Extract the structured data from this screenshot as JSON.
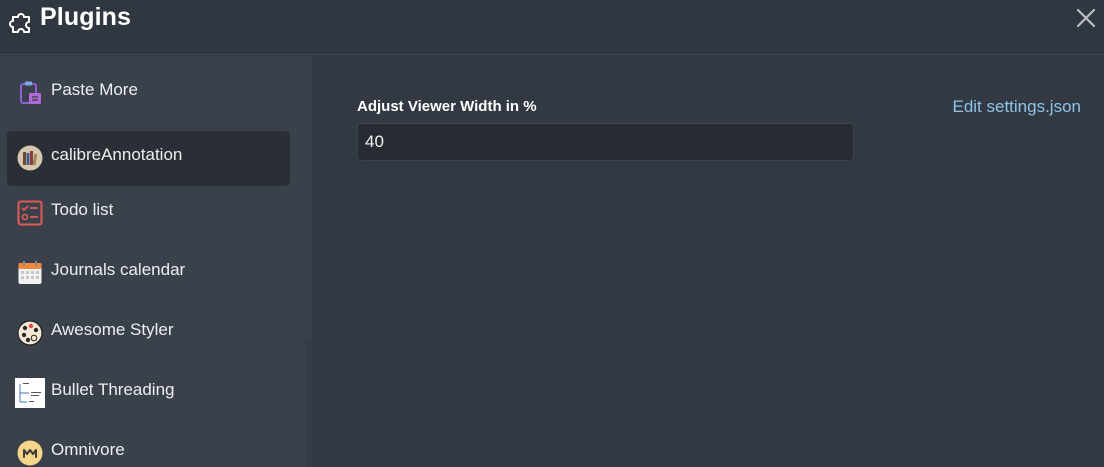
{
  "header": {
    "title": "Plugins",
    "icon": "puzzle-icon",
    "close_icon": "close-icon"
  },
  "sidebar": {
    "items": [
      {
        "label": "Paste More",
        "icon": "clipboard-icon",
        "active": false
      },
      {
        "label": "calibreAnnotation",
        "icon": "books-icon",
        "active": true
      },
      {
        "label": "Todo list",
        "icon": "checklist-icon",
        "active": false
      },
      {
        "label": "Journals calendar",
        "icon": "calendar-icon",
        "active": false
      },
      {
        "label": "Awesome Styler",
        "icon": "palette-icon",
        "active": false
      },
      {
        "label": "Bullet Threading",
        "icon": "thread-diagram-icon",
        "active": false
      },
      {
        "label": "Omnivore",
        "icon": "omnivore-logo-icon",
        "active": false
      }
    ]
  },
  "settings": {
    "field_label": "Adjust Viewer Width in %",
    "field_value": "40",
    "edit_link": "Edit settings.json"
  },
  "colors": {
    "background": "#313741",
    "sidebar": "#3a414b",
    "active_item": "#2a2f36",
    "link": "#8ec3ea",
    "input_bg": "#272b32"
  }
}
